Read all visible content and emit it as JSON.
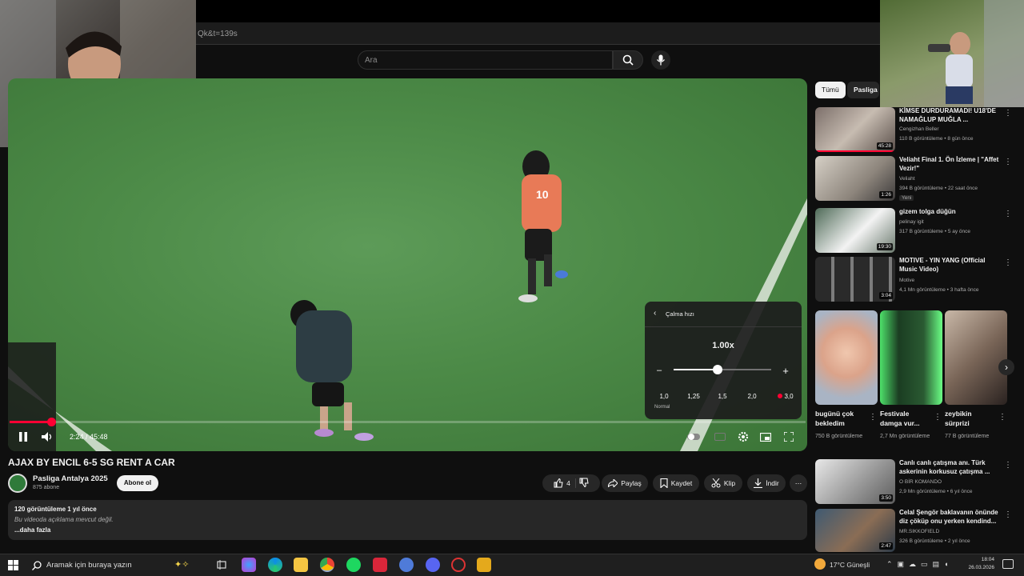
{
  "browser": {
    "url_fragment": "Qk&t=139s"
  },
  "header": {
    "search_placeholder": "Ara"
  },
  "player": {
    "time": "2:24 / 45:48",
    "progress_fraction": 0.052,
    "speed_panel": {
      "title": "Çalma hızı",
      "current": "1.00x",
      "minus": "–",
      "plus": "+",
      "slider_fraction": 0.45,
      "presets": [
        "1,0",
        "1,25",
        "1,5",
        "2,0",
        "3,0"
      ],
      "preset_note": "Normal"
    }
  },
  "video": {
    "title": "AJAX BY ENCIL 6-5 SG RENT A CAR",
    "channel": "Pasliga Antalya 2025",
    "subscribers": "875 abone",
    "subscribe": "Abone ol",
    "likes": "4",
    "share": "Paylaş",
    "save": "Kaydet",
    "clip": "Klip",
    "download": "İndir",
    "description": {
      "stats": "120 görüntüleme  1 yıl önce",
      "text": "Bu videoda açıklama mevcut değil.",
      "more": "...daha fazla"
    }
  },
  "sidebar": {
    "chips": [
      "Tümü",
      "Pasliga A"
    ],
    "recs_top": [
      {
        "title": "KİMSE DURDURAMADI! U18'DE NAMAĞLUP MUĞLA ...",
        "channel": "Cengizhan Beller",
        "views": "110 B görüntüleme • 8 gün önce",
        "duration": "45:28"
      },
      {
        "title": "Veliaht Final 1. Ön İzleme | \"Affet Vezir!\"",
        "channel": "Veliaht",
        "views": "394 B görüntüleme • 22 saat önce",
        "duration": "1:26",
        "badge": "Yeni"
      },
      {
        "title": "gizem tolga düğün",
        "channel": "pelinay igit",
        "views": "317 B görüntüleme • 5 ay önce",
        "duration": "19:30"
      },
      {
        "title": "MOTIVE - YIN YANG (Official Music Video)",
        "channel": "Motive",
        "views": "4,1 Mn görüntüleme • 3 hafta önce",
        "duration": "3:04"
      }
    ],
    "shorts": [
      {
        "title": "bugünü çok bekledim",
        "views": "750 B görüntüleme"
      },
      {
        "title": "Festivale damga vur...",
        "views": "2,7 Mn görüntüleme"
      },
      {
        "title": "zeybikin sürprizi",
        "views": "77 B görüntüleme"
      }
    ],
    "recs_bottom": [
      {
        "title": "Canlı canlı çatışma anı. Türk askerinin korkusuz çatışma ...",
        "channel": "O BİR KOMANDO",
        "views": "2,9 Mn görüntüleme • 6 yıl önce",
        "duration": "3:50"
      },
      {
        "title": "Celal Şengör baklavanın önünde diz çöküp onu yerken kendind...",
        "channel": "MR.SIKKOFIELD",
        "views": "326 B görüntüleme • 2 yıl önce",
        "duration": "2:47"
      }
    ]
  },
  "taskbar": {
    "search_placeholder": "Aramak için buraya yazın",
    "weather": "17°C  Güneşli",
    "time": "18:04",
    "date": "26.03.2026"
  },
  "colors": {
    "accent": "#ff0033",
    "page_bg": "#0f0f0f",
    "pill_bg": "#272727"
  }
}
